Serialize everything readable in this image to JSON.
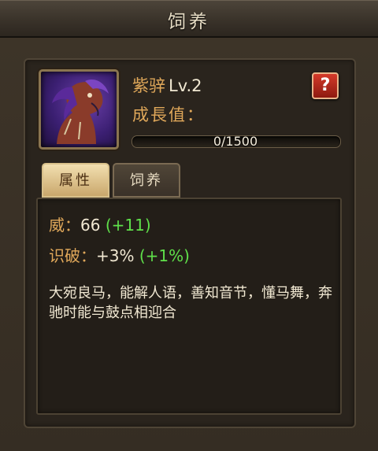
{
  "window": {
    "title": "饲养"
  },
  "mount": {
    "name": "紫骍",
    "level": "Lv.2",
    "growth_label": "成長值：",
    "growth_current": 0,
    "growth_max": 1500,
    "growth_text": "0/1500",
    "growth_fraction": 0.0,
    "portrait_icon": "horse-portrait-icon"
  },
  "help": {
    "label": "?"
  },
  "tabs": [
    {
      "label": "属性",
      "active": true
    },
    {
      "label": "饲养",
      "active": false
    }
  ],
  "stats": [
    {
      "label": "威：",
      "value": "66",
      "bonus": "(+11)"
    },
    {
      "label": "识破：",
      "value": "+3%",
      "bonus": "(+1%)"
    }
  ],
  "description": "大宛良马，能解人语，善知音节，懂马舞，奔驰时能与鼓点相迎合",
  "colors": {
    "label_gold": "#e0a85a",
    "bonus_green": "#5fe04a",
    "help_red": "#c0301f"
  }
}
